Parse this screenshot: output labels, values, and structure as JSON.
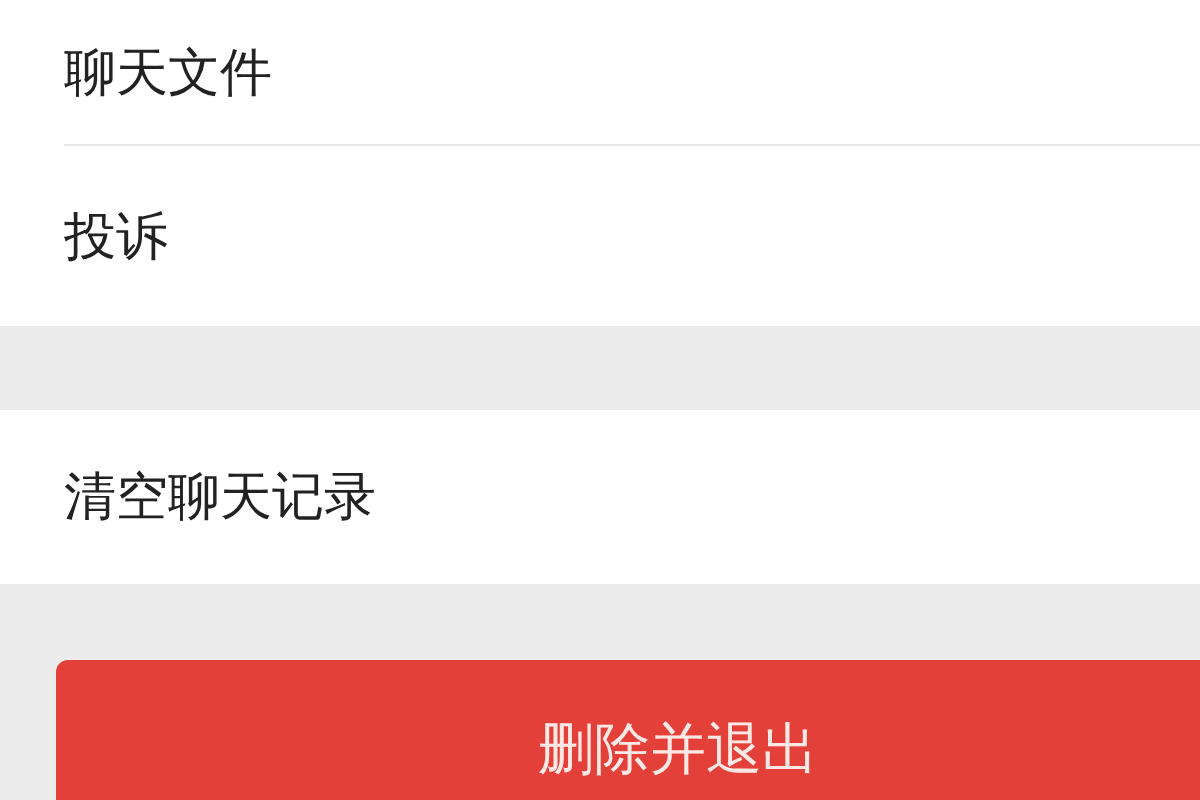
{
  "sections": [
    {
      "items": [
        "聊天文件",
        "投诉"
      ]
    },
    {
      "items": [
        "清空聊天记录"
      ]
    }
  ],
  "delete_button": {
    "label": "删除并退出"
  }
}
